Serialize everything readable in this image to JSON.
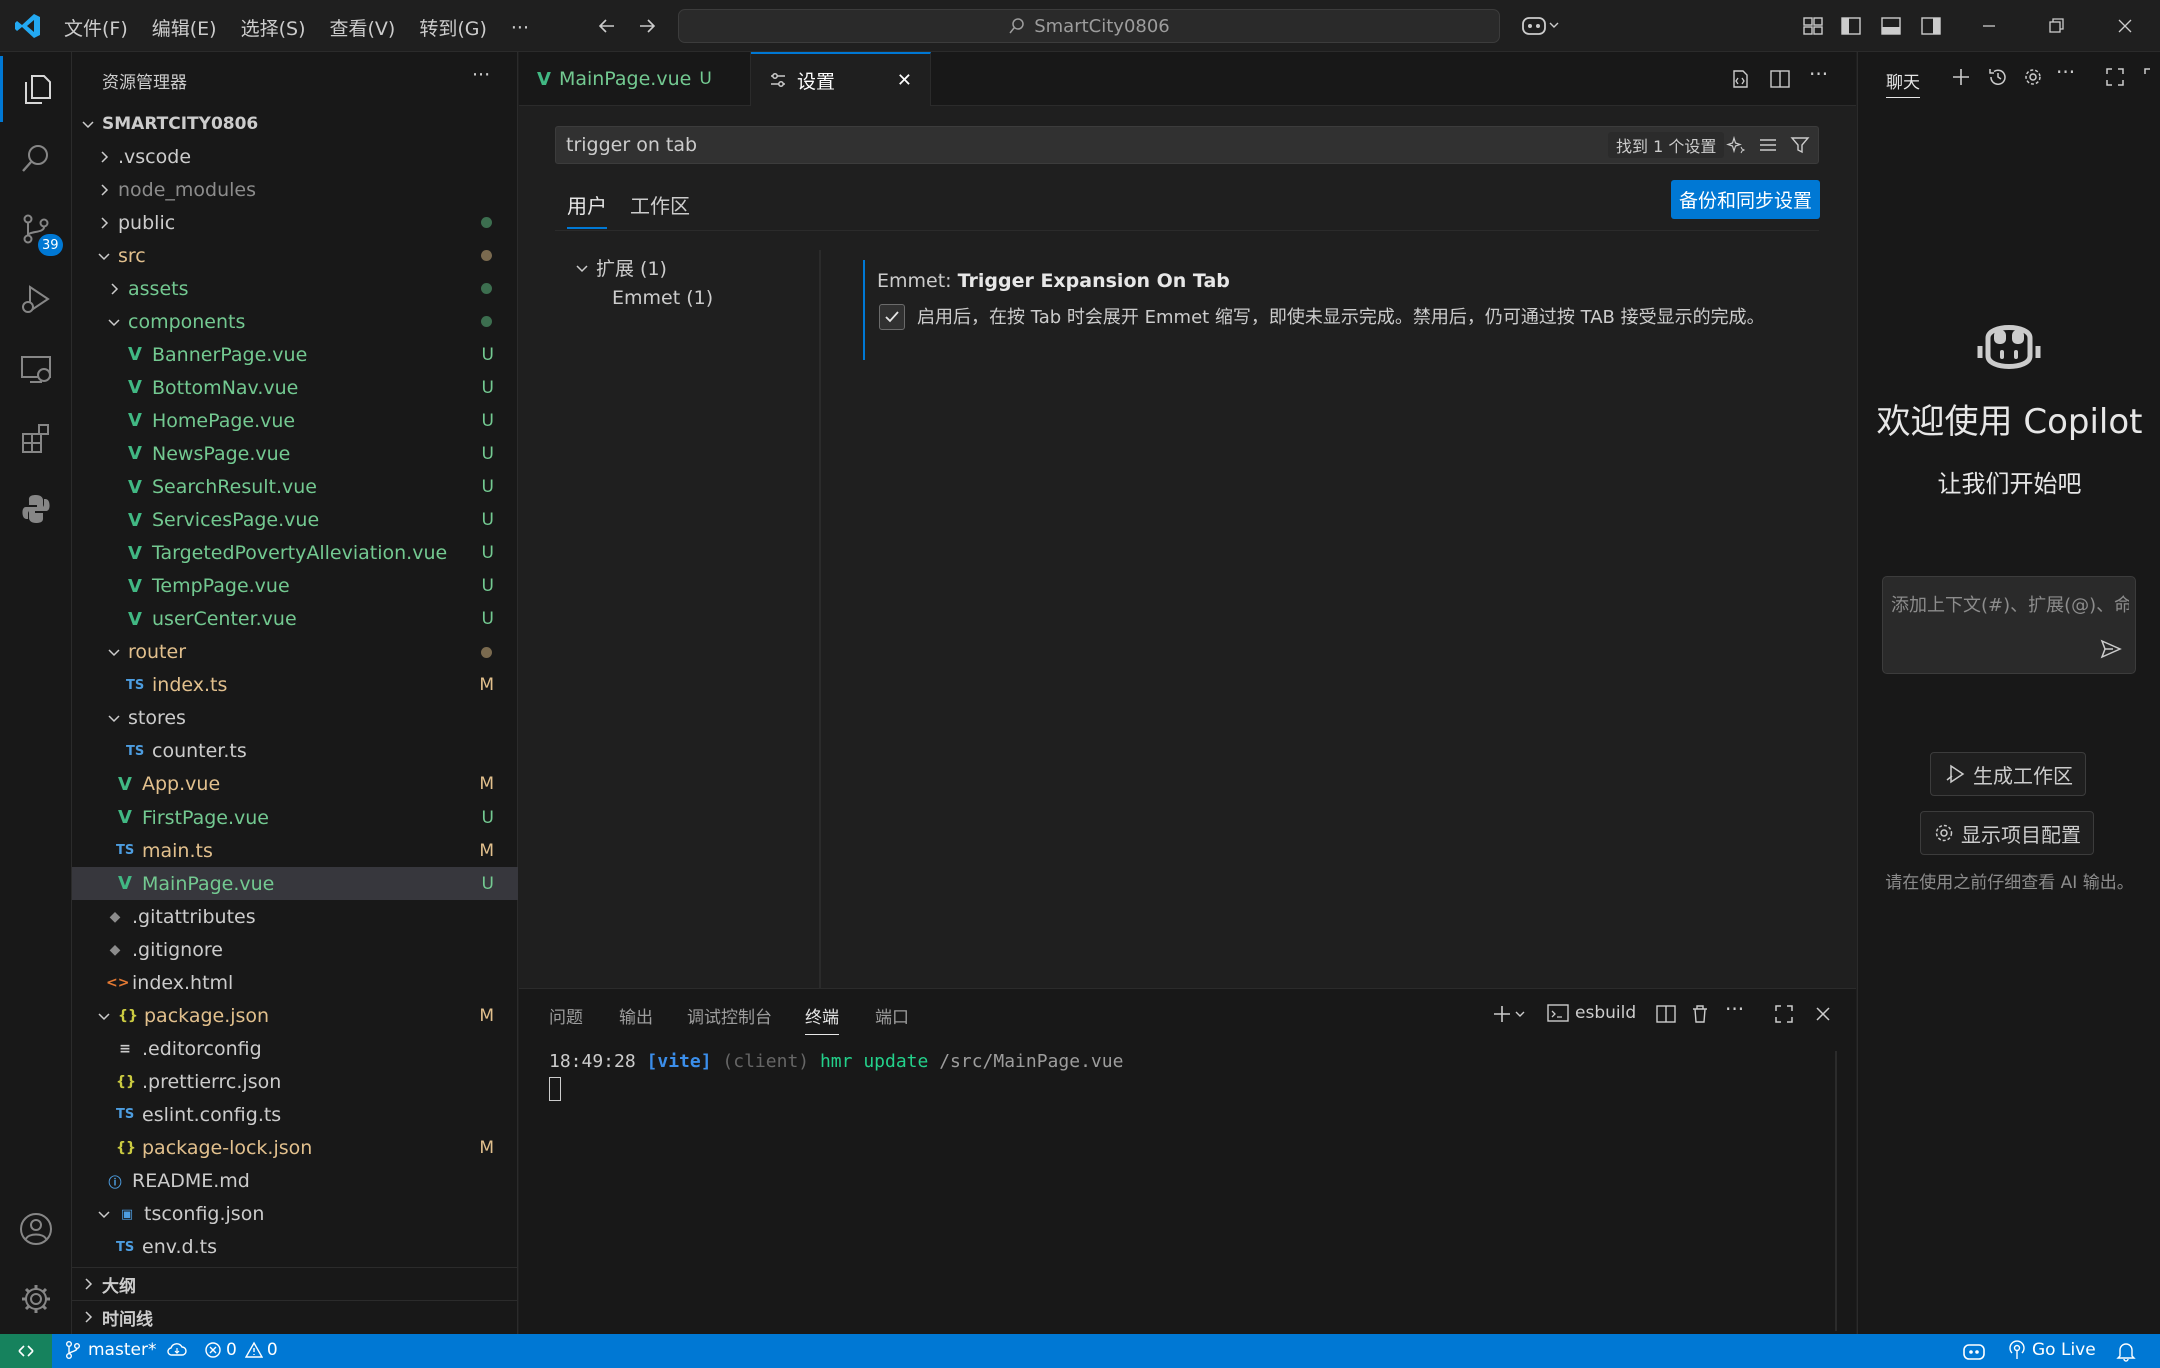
{
  "titlebar": {
    "menus": [
      "文件(F)",
      "编辑(E)",
      "选择(S)",
      "查看(V)",
      "转到(G)",
      "···"
    ],
    "search_text": "SmartCity0806"
  },
  "activity": {
    "scm_badge": "39"
  },
  "explorer": {
    "title": "资源管理器",
    "more": "···",
    "root": "SMARTCITY0806",
    "items": [
      {
        "label": ".vscode",
        "indent": 1,
        "chev": "right",
        "icon": "",
        "cls": "",
        "deco": ""
      },
      {
        "label": "node_modules",
        "indent": 1,
        "chev": "right",
        "icon": "",
        "cls": "dim",
        "deco": ""
      },
      {
        "label": "public",
        "indent": 1,
        "chev": "right",
        "icon": "",
        "cls": "",
        "deco": "dot-green"
      },
      {
        "label": "src",
        "indent": 1,
        "chev": "down",
        "icon": "",
        "cls": "yellow",
        "deco": "dot-yellow"
      },
      {
        "label": "assets",
        "indent": 2,
        "chev": "right",
        "icon": "",
        "cls": "green",
        "deco": "dot-green"
      },
      {
        "label": "components",
        "indent": 2,
        "chev": "down",
        "icon": "",
        "cls": "green",
        "deco": "dot-green"
      },
      {
        "label": "BannerPage.vue",
        "indent": 3,
        "chev": "",
        "icon": "vue",
        "cls": "green",
        "deco": "U"
      },
      {
        "label": "BottomNav.vue",
        "indent": 3,
        "chev": "",
        "icon": "vue",
        "cls": "green",
        "deco": "U"
      },
      {
        "label": "HomePage.vue",
        "indent": 3,
        "chev": "",
        "icon": "vue",
        "cls": "green",
        "deco": "U"
      },
      {
        "label": "NewsPage.vue",
        "indent": 3,
        "chev": "",
        "icon": "vue",
        "cls": "green",
        "deco": "U"
      },
      {
        "label": "SearchResult.vue",
        "indent": 3,
        "chev": "",
        "icon": "vue",
        "cls": "green",
        "deco": "U"
      },
      {
        "label": "ServicesPage.vue",
        "indent": 3,
        "chev": "",
        "icon": "vue",
        "cls": "green",
        "deco": "U"
      },
      {
        "label": "TargetedPovertyAlleviation.vue",
        "indent": 3,
        "chev": "",
        "icon": "vue",
        "cls": "green",
        "deco": "U"
      },
      {
        "label": "TempPage.vue",
        "indent": 3,
        "chev": "",
        "icon": "vue",
        "cls": "green",
        "deco": "U"
      },
      {
        "label": "userCenter.vue",
        "indent": 3,
        "chev": "",
        "icon": "vue",
        "cls": "green",
        "deco": "U"
      },
      {
        "label": "router",
        "indent": 2,
        "chev": "down",
        "icon": "",
        "cls": "yellow",
        "deco": "dot-yellow"
      },
      {
        "label": "index.ts",
        "indent": 3,
        "chev": "",
        "icon": "ts",
        "cls": "yellow",
        "deco": "M"
      },
      {
        "label": "stores",
        "indent": 2,
        "chev": "down",
        "icon": "",
        "cls": "",
        "deco": ""
      },
      {
        "label": "counter.ts",
        "indent": 3,
        "chev": "",
        "icon": "ts",
        "cls": "",
        "deco": ""
      },
      {
        "label": "App.vue",
        "indent": 2,
        "chev": "",
        "icon": "vue",
        "cls": "yellow",
        "deco": "M"
      },
      {
        "label": "FirstPage.vue",
        "indent": 2,
        "chev": "",
        "icon": "vue",
        "cls": "green",
        "deco": "U"
      },
      {
        "label": "main.ts",
        "indent": 2,
        "chev": "",
        "icon": "ts",
        "cls": "yellow",
        "deco": "M"
      },
      {
        "label": "MainPage.vue",
        "indent": 2,
        "chev": "",
        "icon": "vue",
        "cls": "green",
        "deco": "U",
        "selected": true
      },
      {
        "label": ".gitattributes",
        "indent": 1,
        "chev": "",
        "icon": "git",
        "cls": "",
        "deco": ""
      },
      {
        "label": ".gitignore",
        "indent": 1,
        "chev": "",
        "icon": "git",
        "cls": "",
        "deco": ""
      },
      {
        "label": "index.html",
        "indent": 1,
        "chev": "",
        "icon": "html",
        "cls": "",
        "deco": ""
      },
      {
        "label": "package.json",
        "indent": 1,
        "chev": "down",
        "icon": "json",
        "cls": "yellow",
        "deco": "M"
      },
      {
        "label": ".editorconfig",
        "indent": 2,
        "chev": "",
        "icon": "lines",
        "cls": "",
        "deco": ""
      },
      {
        "label": ".prettierrc.json",
        "indent": 2,
        "chev": "",
        "icon": "json",
        "cls": "",
        "deco": ""
      },
      {
        "label": "eslint.config.ts",
        "indent": 2,
        "chev": "",
        "icon": "ts",
        "cls": "",
        "deco": ""
      },
      {
        "label": "package-lock.json",
        "indent": 2,
        "chev": "",
        "icon": "json",
        "cls": "yellow",
        "deco": "M"
      },
      {
        "label": "README.md",
        "indent": 1,
        "chev": "",
        "icon": "info",
        "cls": "",
        "deco": ""
      },
      {
        "label": "tsconfig.json",
        "indent": 1,
        "chev": "down",
        "icon": "tsconfig",
        "cls": "",
        "deco": ""
      },
      {
        "label": "env.d.ts",
        "indent": 2,
        "chev": "",
        "icon": "ts",
        "cls": "",
        "deco": ""
      }
    ],
    "outline": "大纲",
    "timeline": "时间线"
  },
  "tabs": [
    {
      "label": "MainPage.vue",
      "status": "U"
    },
    {
      "label": "设置",
      "close": "✕"
    }
  ],
  "settings": {
    "search_value": "trigger on tab",
    "found": "找到 1 个设置",
    "scope_tabs": [
      "用户",
      "工作区"
    ],
    "sync_button": "备份和同步设置",
    "toc": [
      {
        "label": "扩展 (1)"
      },
      {
        "label": "Emmet (1)"
      }
    ],
    "item_category": "Emmet: ",
    "item_title": "Trigger Expansion On Tab",
    "item_description": "启用后，在按 Tab 时会展开 Emmet 缩写，即使未显示完成。禁用后，仍可通过按 TAB 接受显示的完成。",
    "checked": true
  },
  "panel": {
    "tabs": [
      "问题",
      "输出",
      "调试控制台",
      "终端",
      "端口"
    ],
    "active_tab": "终端",
    "terminal_name": "esbuild",
    "terminal_line": {
      "time": "18:49:28",
      "tag": "[vite]",
      "client": "(client)",
      "action": "hmr update",
      "path": "/src/MainPage.vue"
    }
  },
  "chat": {
    "title": "聊天",
    "welcome": "欢迎使用 Copilot",
    "subtitle": "让我们开始吧",
    "input_placeholder": "添加上下文(#)、扩展(@)、命令",
    "btn_workspace": "生成工作区",
    "btn_config": "显示项目配置",
    "disclaimer": "请在使用之前仔细查看 AI 输出。"
  },
  "statusbar": {
    "branch": "master*",
    "errors": "0",
    "warnings": "0",
    "golive": "Go Live"
  }
}
